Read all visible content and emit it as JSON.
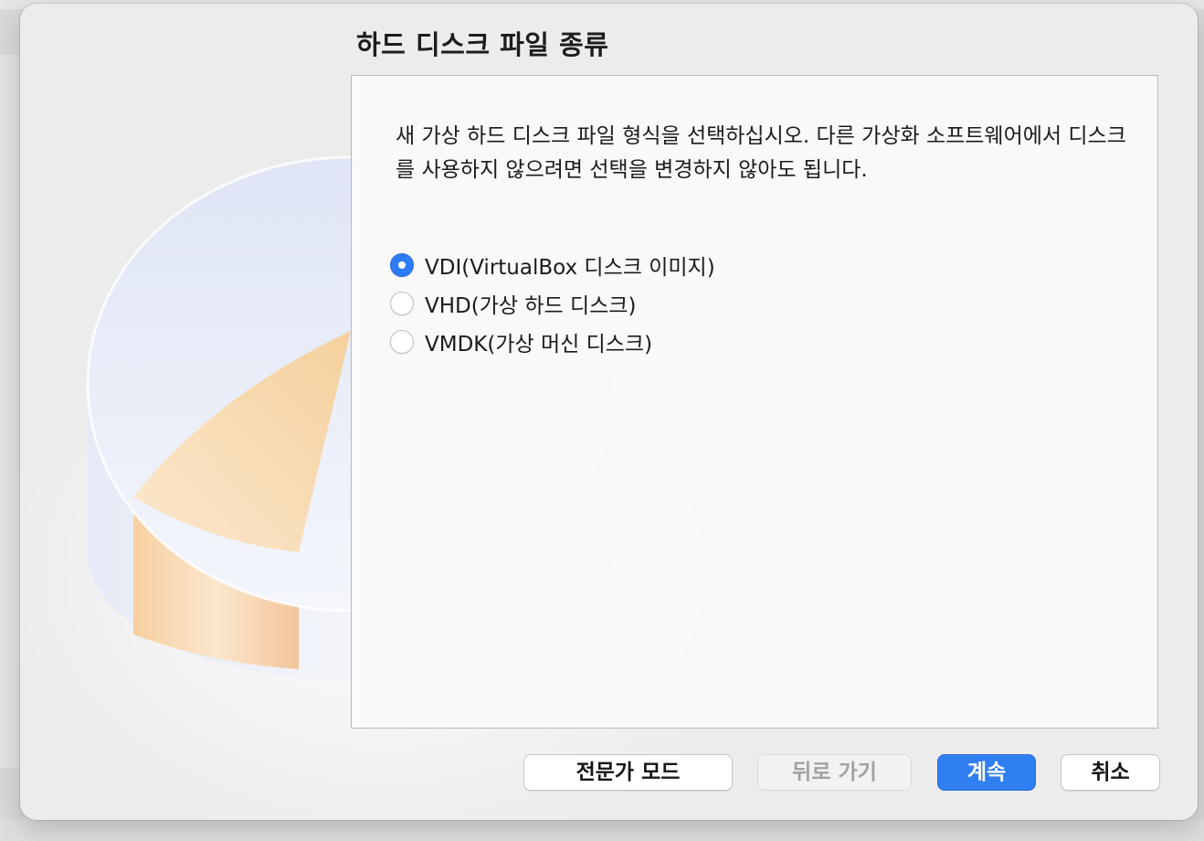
{
  "dialog": {
    "title": "하드 디스크 파일 종류",
    "description": "새 가상 하드 디스크 파일 형식을 선택하십시오. 다른 가상화 소프트웨어에서 디스크를 사용하지 않으려면 선택을 변경하지 않아도 됩니다.",
    "options": [
      {
        "label": "VDI(VirtualBox 디스크 이미지)",
        "checked": true
      },
      {
        "label": "VHD(가상 하드 디스크)",
        "checked": false
      },
      {
        "label": "VMDK(가상 머신 디스크)",
        "checked": false
      }
    ]
  },
  "buttons": {
    "expert_mode": "전문가 모드",
    "back": "뒤로 가기",
    "continue": "계속",
    "cancel": "취소"
  },
  "colors": {
    "accent": "#2f7ff3",
    "sheet_background": "#ececec",
    "disk_slice": "#f6d7a6"
  },
  "icons": {
    "background_graphic": "hard-disk-pie-icon"
  }
}
